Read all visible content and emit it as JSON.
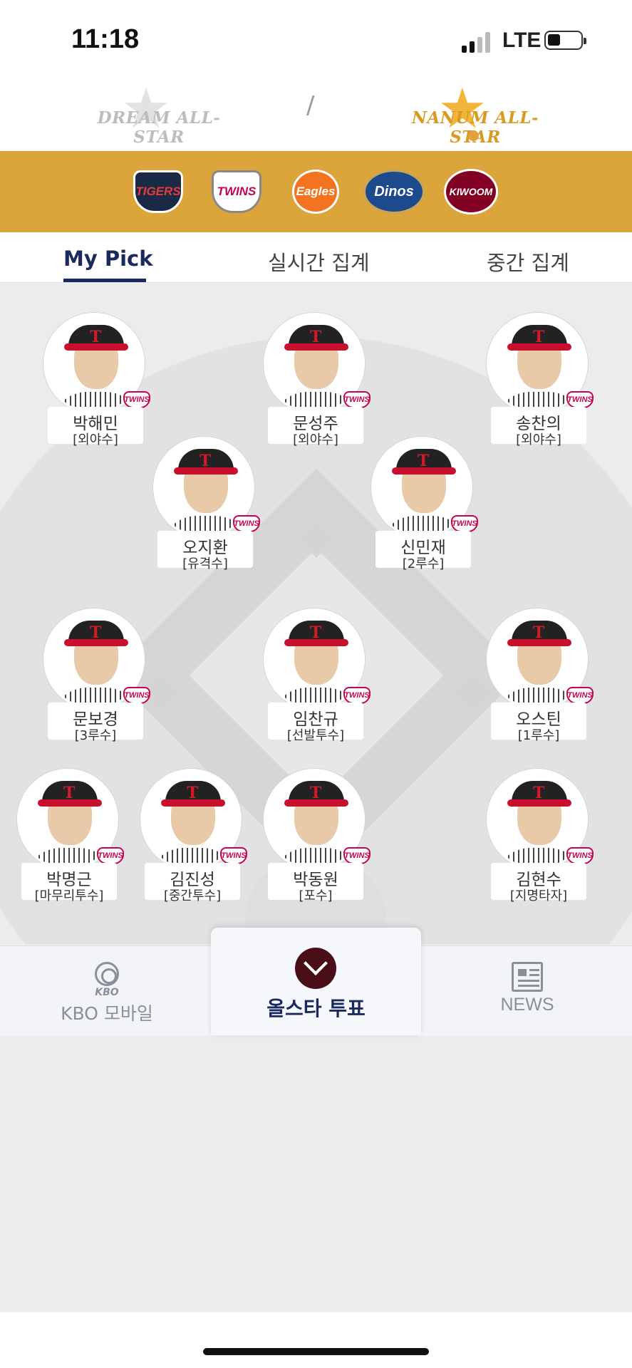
{
  "status": {
    "time": "11:18",
    "network": "LTE",
    "battery_level": 0.3
  },
  "allstar": {
    "left": "DREAM ALL-STAR",
    "separator": "/",
    "right": "NANUM ALL-STAR",
    "selected": "right"
  },
  "teams": [
    "TIGERS",
    "TWINS",
    "Eagles",
    "Dinos",
    "KIWOOM"
  ],
  "tabs": {
    "my_pick": "My Pick",
    "realtime": "실시간 집계",
    "interim": "중간 집계",
    "active": "my_pick"
  },
  "team_mark": "TWINS",
  "cap_logo": "T",
  "players": [
    {
      "name": "박해민",
      "position": "[외야수]"
    },
    {
      "name": "문성주",
      "position": "[외야수]"
    },
    {
      "name": "송찬의",
      "position": "[외야수]"
    },
    {
      "name": "오지환",
      "position": "[유격수]"
    },
    {
      "name": "신민재",
      "position": "[2루수]"
    },
    {
      "name": "문보경",
      "position": "[3루수]"
    },
    {
      "name": "임찬규",
      "position": "[선발투수]"
    },
    {
      "name": "오스틴",
      "position": "[1루수]"
    },
    {
      "name": "박명근",
      "position": "[마무리투수]"
    },
    {
      "name": "김진성",
      "position": "[중간투수]"
    },
    {
      "name": "박동원",
      "position": "[포수]"
    },
    {
      "name": "김현수",
      "position": "[지명타자]"
    }
  ],
  "nav": {
    "kbo_icon_text": "KBO",
    "kbo": "KBO 모바일",
    "vote": "올스타 투표",
    "news": "NEWS"
  },
  "colors": {
    "gold": "#dca53c",
    "navy": "#1a2a5e",
    "maroon": "#4a0e18"
  }
}
